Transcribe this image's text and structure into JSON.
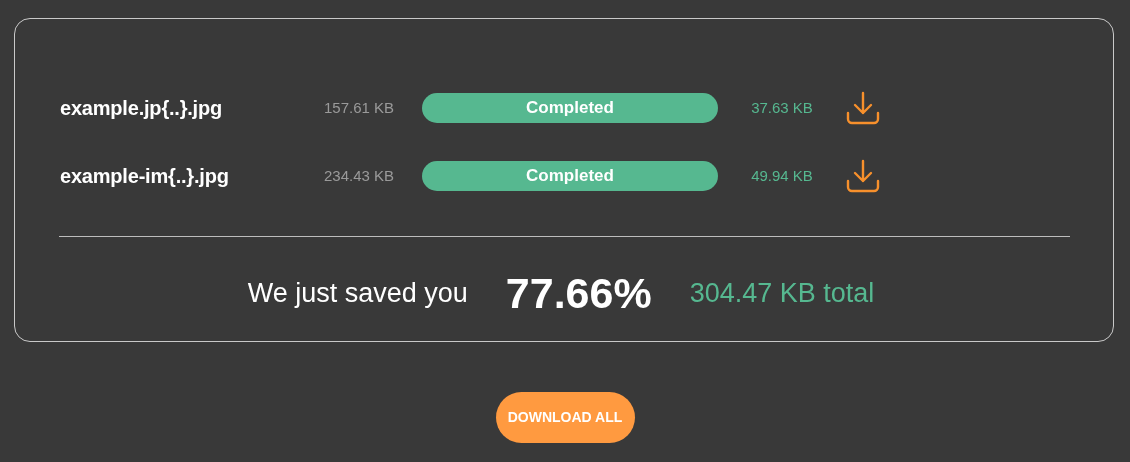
{
  "files": [
    {
      "name": "example.jp{..}.jpg",
      "original_size": "157.61 KB",
      "status": "Completed",
      "compressed_size": "37.63 KB"
    },
    {
      "name": "example-im{..}.jpg",
      "original_size": "234.43 KB",
      "status": "Completed",
      "compressed_size": "49.94 KB"
    }
  ],
  "summary": {
    "text": "We just saved you",
    "percent": "77.66%",
    "total": "304.47 KB total"
  },
  "download_all_button": "DOWNLOAD ALL"
}
